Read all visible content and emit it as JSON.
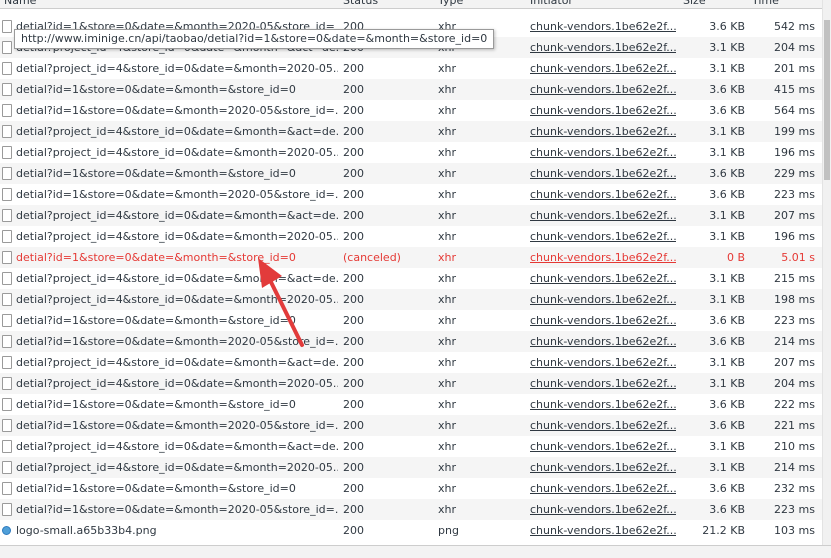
{
  "header": {
    "name": "Name",
    "status": "Status",
    "type": "Type",
    "initiator": "Initiator",
    "size": "Size",
    "time": "Time"
  },
  "tooltip": "http://www.iminige.cn/api/taobao/detial?id=1&store=0&date=&month=&store_id=0",
  "rows": [
    {
      "name": "detial?id=1&store=0&date=&month=2020-05&store_id=",
      "status": "200",
      "type": "xhr",
      "initiator": "chunk-vendors.1be62e2f...",
      "size": "3.6 KB",
      "time": "542 ms",
      "icon": "file"
    },
    {
      "name": "detial?project_id=4&store_id=0&date=&month=&act=de...",
      "status": "200",
      "type": "xhr",
      "initiator": "chunk-vendors.1be62e2f...",
      "size": "3.1 KB",
      "time": "204 ms",
      "icon": "file"
    },
    {
      "name": "detial?project_id=4&store_id=0&date=&month=2020-05...",
      "status": "200",
      "type": "xhr",
      "initiator": "chunk-vendors.1be62e2f...",
      "size": "3.1 KB",
      "time": "201 ms",
      "icon": "file"
    },
    {
      "name": "detial?id=1&store=0&date=&month=&store_id=0",
      "status": "200",
      "type": "xhr",
      "initiator": "chunk-vendors.1be62e2f...",
      "size": "3.6 KB",
      "time": "415 ms",
      "icon": "file"
    },
    {
      "name": "detial?id=1&store=0&date=&month=2020-05&store_id=...",
      "status": "200",
      "type": "xhr",
      "initiator": "chunk-vendors.1be62e2f...",
      "size": "3.6 KB",
      "time": "564 ms",
      "icon": "file"
    },
    {
      "name": "detial?project_id=4&store_id=0&date=&month=&act=de...",
      "status": "200",
      "type": "xhr",
      "initiator": "chunk-vendors.1be62e2f...",
      "size": "3.1 KB",
      "time": "199 ms",
      "icon": "file"
    },
    {
      "name": "detial?project_id=4&store_id=0&date=&month=2020-05...",
      "status": "200",
      "type": "xhr",
      "initiator": "chunk-vendors.1be62e2f...",
      "size": "3.1 KB",
      "time": "196 ms",
      "icon": "file"
    },
    {
      "name": "detial?id=1&store=0&date=&month=&store_id=0",
      "status": "200",
      "type": "xhr",
      "initiator": "chunk-vendors.1be62e2f...",
      "size": "3.6 KB",
      "time": "229 ms",
      "icon": "file"
    },
    {
      "name": "detial?id=1&store=0&date=&month=2020-05&store_id=...",
      "status": "200",
      "type": "xhr",
      "initiator": "chunk-vendors.1be62e2f...",
      "size": "3.6 KB",
      "time": "223 ms",
      "icon": "file"
    },
    {
      "name": "detial?project_id=4&store_id=0&date=&month=&act=de...",
      "status": "200",
      "type": "xhr",
      "initiator": "chunk-vendors.1be62e2f...",
      "size": "3.1 KB",
      "time": "207 ms",
      "icon": "file"
    },
    {
      "name": "detial?project_id=4&store_id=0&date=&month=2020-05...",
      "status": "200",
      "type": "xhr",
      "initiator": "chunk-vendors.1be62e2f...",
      "size": "3.1 KB",
      "time": "196 ms",
      "icon": "file"
    },
    {
      "name": "detial?id=1&store=0&date=&month=&store_id=0",
      "status": "(canceled)",
      "type": "xhr",
      "initiator": "chunk-vendors.1be62e2f...",
      "size": "0 B",
      "time": "5.01 s",
      "icon": "file",
      "canceled": true
    },
    {
      "name": "detial?project_id=4&store_id=0&date=&month=&act=de...",
      "status": "200",
      "type": "xhr",
      "initiator": "chunk-vendors.1be62e2f...",
      "size": "3.1 KB",
      "time": "215 ms",
      "icon": "file"
    },
    {
      "name": "detial?project_id=4&store_id=0&date=&month=2020-05...",
      "status": "200",
      "type": "xhr",
      "initiator": "chunk-vendors.1be62e2f...",
      "size": "3.1 KB",
      "time": "198 ms",
      "icon": "file"
    },
    {
      "name": "detial?id=1&store=0&date=&month=&store_id=0",
      "status": "200",
      "type": "xhr",
      "initiator": "chunk-vendors.1be62e2f...",
      "size": "3.6 KB",
      "time": "223 ms",
      "icon": "file"
    },
    {
      "name": "detial?id=1&store=0&date=&month=2020-05&store_id=...",
      "status": "200",
      "type": "xhr",
      "initiator": "chunk-vendors.1be62e2f...",
      "size": "3.6 KB",
      "time": "214 ms",
      "icon": "file"
    },
    {
      "name": "detial?project_id=4&store_id=0&date=&month=&act=de...",
      "status": "200",
      "type": "xhr",
      "initiator": "chunk-vendors.1be62e2f...",
      "size": "3.1 KB",
      "time": "207 ms",
      "icon": "file"
    },
    {
      "name": "detial?project_id=4&store_id=0&date=&month=2020-05...",
      "status": "200",
      "type": "xhr",
      "initiator": "chunk-vendors.1be62e2f...",
      "size": "3.1 KB",
      "time": "204 ms",
      "icon": "file"
    },
    {
      "name": "detial?id=1&store=0&date=&month=&store_id=0",
      "status": "200",
      "type": "xhr",
      "initiator": "chunk-vendors.1be62e2f...",
      "size": "3.6 KB",
      "time": "222 ms",
      "icon": "file"
    },
    {
      "name": "detial?id=1&store=0&date=&month=2020-05&store_id=...",
      "status": "200",
      "type": "xhr",
      "initiator": "chunk-vendors.1be62e2f...",
      "size": "3.6 KB",
      "time": "221 ms",
      "icon": "file"
    },
    {
      "name": "detial?project_id=4&store_id=0&date=&month=&act=de...",
      "status": "200",
      "type": "xhr",
      "initiator": "chunk-vendors.1be62e2f...",
      "size": "3.1 KB",
      "time": "210 ms",
      "icon": "file"
    },
    {
      "name": "detial?project_id=4&store_id=0&date=&month=2020-05...",
      "status": "200",
      "type": "xhr",
      "initiator": "chunk-vendors.1be62e2f...",
      "size": "3.1 KB",
      "time": "214 ms",
      "icon": "file"
    },
    {
      "name": "detial?id=1&store=0&date=&month=&store_id=0",
      "status": "200",
      "type": "xhr",
      "initiator": "chunk-vendors.1be62e2f...",
      "size": "3.6 KB",
      "time": "232 ms",
      "icon": "file"
    },
    {
      "name": "detial?id=1&store=0&date=&month=2020-05&store_id=...",
      "status": "200",
      "type": "xhr",
      "initiator": "chunk-vendors.1be62e2f...",
      "size": "3.6 KB",
      "time": "223 ms",
      "icon": "file"
    },
    {
      "name": "logo-small.a65b33b4.png",
      "status": "200",
      "type": "png",
      "initiator": "chunk-vendors.1be62e2f...",
      "size": "21.2 KB",
      "time": "103 ms",
      "icon": "image"
    }
  ],
  "colors": {
    "canceled": "#e53935",
    "annotation_arrow": "#e23b3b"
  }
}
